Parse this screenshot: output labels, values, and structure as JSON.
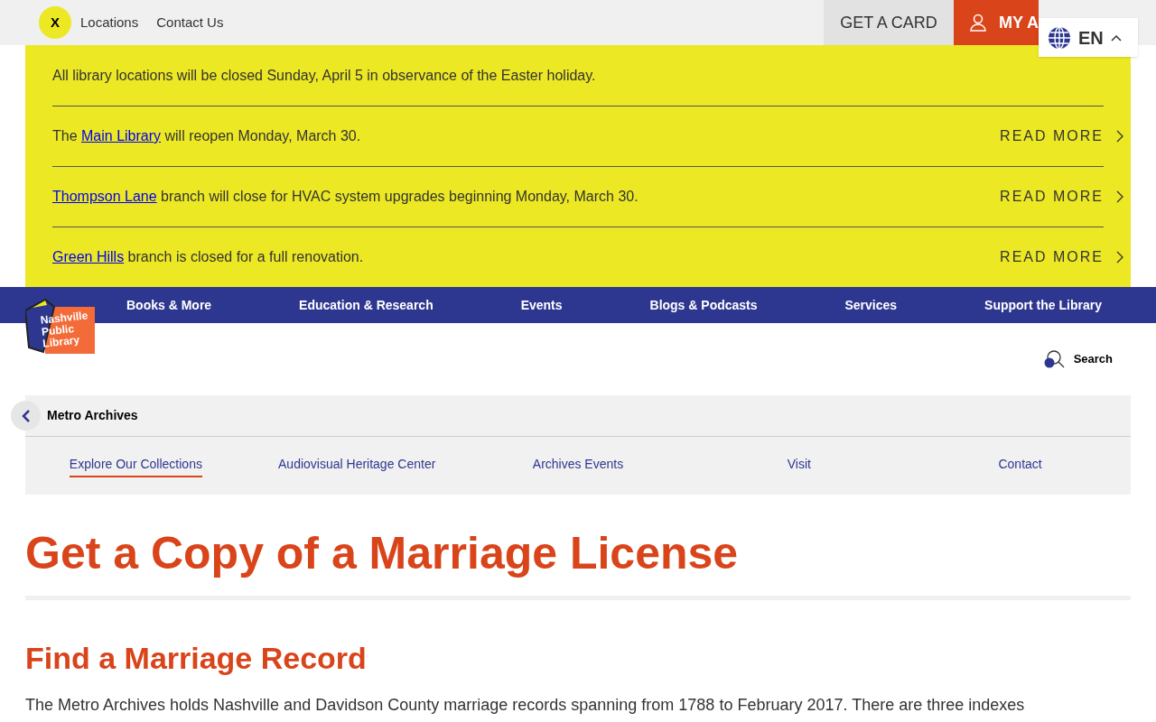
{
  "utility_bar": {
    "close_label": "X",
    "links": [
      "Locations",
      "Contact Us"
    ],
    "get_card": "GET A CARD",
    "my_account": "MY A",
    "language": "EN"
  },
  "alerts": [
    {
      "kind": "plain",
      "text": "All library locations will be closed Sunday, April 5 in observance of the Easter holiday."
    },
    {
      "kind": "linked",
      "prefix": "The ",
      "link": "Main Library",
      "suffix": " will reopen Monday, March 30.",
      "action": "READ MORE"
    },
    {
      "kind": "linked",
      "link": "Thompson Lane",
      "suffix": " branch will close for HVAC system upgrades beginning Monday, March 30.",
      "action": "READ MORE"
    },
    {
      "kind": "linked",
      "link": "Green Hills",
      "suffix": " branch is closed for a full renovation.",
      "action": "READ MORE"
    }
  ],
  "main_nav": [
    "Books & More",
    "Education & Research",
    "Events",
    "Blogs & Podcasts",
    "Services",
    "Support the Library"
  ],
  "logo": {
    "lines": [
      "Nashville",
      "Public",
      "Library"
    ]
  },
  "search": {
    "label": "Search"
  },
  "section_nav": {
    "title": "Metro Archives",
    "items": [
      {
        "label": "Explore Our Collections",
        "selected": true
      },
      {
        "label": "Audiovisual Heritage Center",
        "selected": false
      },
      {
        "label": "Archives Events",
        "selected": false
      },
      {
        "label": "Visit",
        "selected": false
      },
      {
        "label": "Contact",
        "selected": false
      }
    ]
  },
  "page_title": "Get a Copy of a Marriage License",
  "section_heading": "Find a Marriage Record",
  "paragraph": "The Metro Archives holds Nashville and Davidson County marriage records spanning from 1788 to February 2017. There are three indexes"
}
